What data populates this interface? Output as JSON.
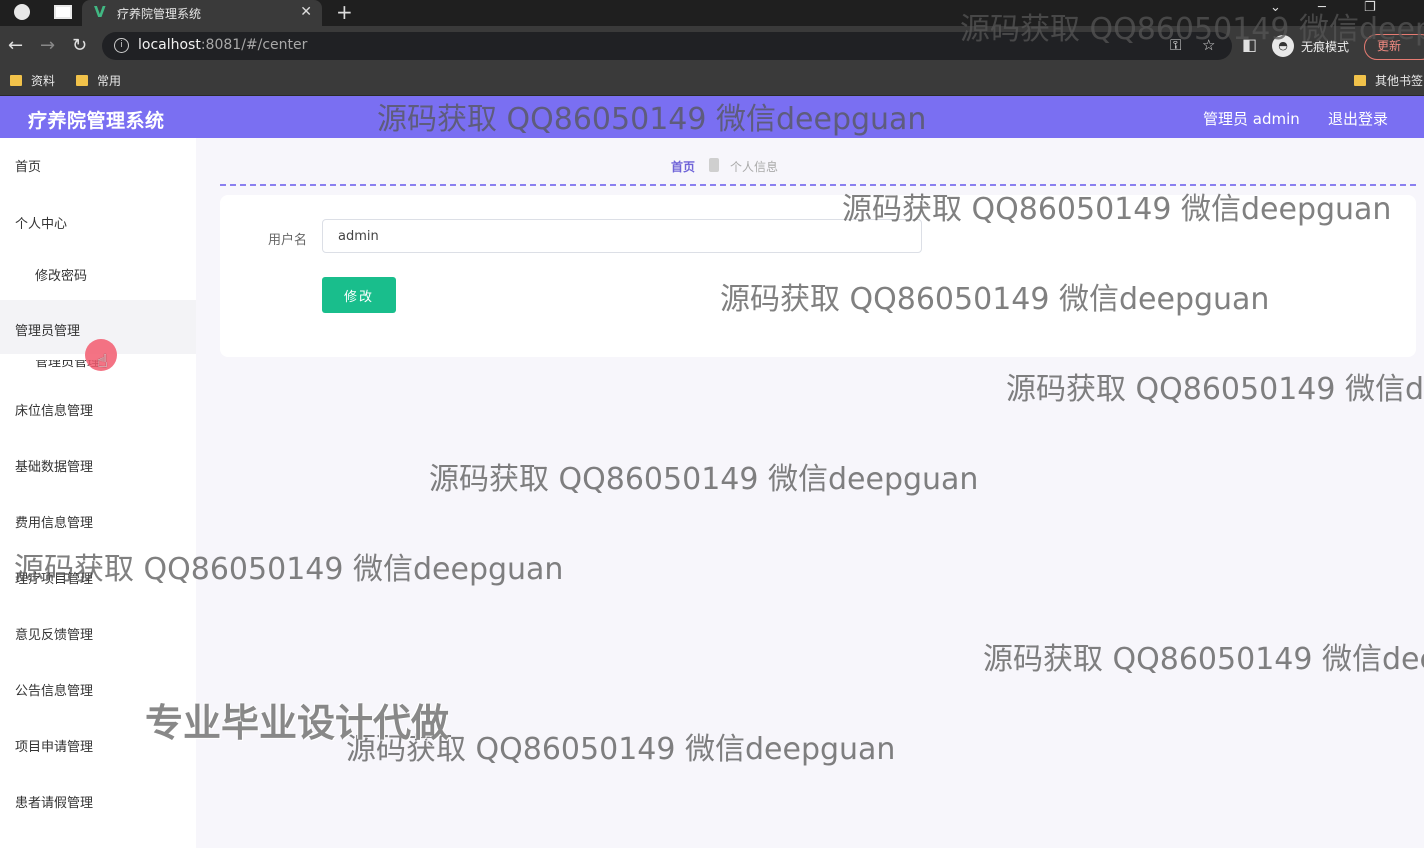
{
  "browser": {
    "tab_title": "疗养院管理系统",
    "url_host": "localhost",
    "url_rest": ":8081/#/center",
    "incognito_label": "无痕模式",
    "update_label": "更新",
    "bookmarks": [
      "资料",
      "常用",
      "其他书签"
    ]
  },
  "header": {
    "app_title": "疗养院管理系统",
    "user_label": "管理员 admin",
    "logout_label": "退出登录",
    "accent_color": "#7a6ff2"
  },
  "sidebar": {
    "items": [
      {
        "label": "首页"
      },
      {
        "label": "个人中心"
      },
      {
        "label": "修改密码"
      },
      {
        "label": "管理员管理"
      },
      {
        "label": "管理员管理"
      },
      {
        "label": "床位信息管理"
      },
      {
        "label": "基础数据管理"
      },
      {
        "label": "费用信息管理"
      },
      {
        "label": "理疗项目管理"
      },
      {
        "label": "意见反馈管理"
      },
      {
        "label": "公告信息管理"
      },
      {
        "label": "项目申请管理"
      },
      {
        "label": "患者请假管理"
      }
    ]
  },
  "breadcrumb": {
    "home": "首页",
    "current": "个人信息"
  },
  "form": {
    "username_label": "用户名",
    "username_value": "admin",
    "submit_label": "修改",
    "submit_color": "#19be8c"
  },
  "overlay": {
    "watermark_text": "源码获取 QQ86050149 微信deepguan",
    "promo_text": "专业毕业设计代做"
  }
}
